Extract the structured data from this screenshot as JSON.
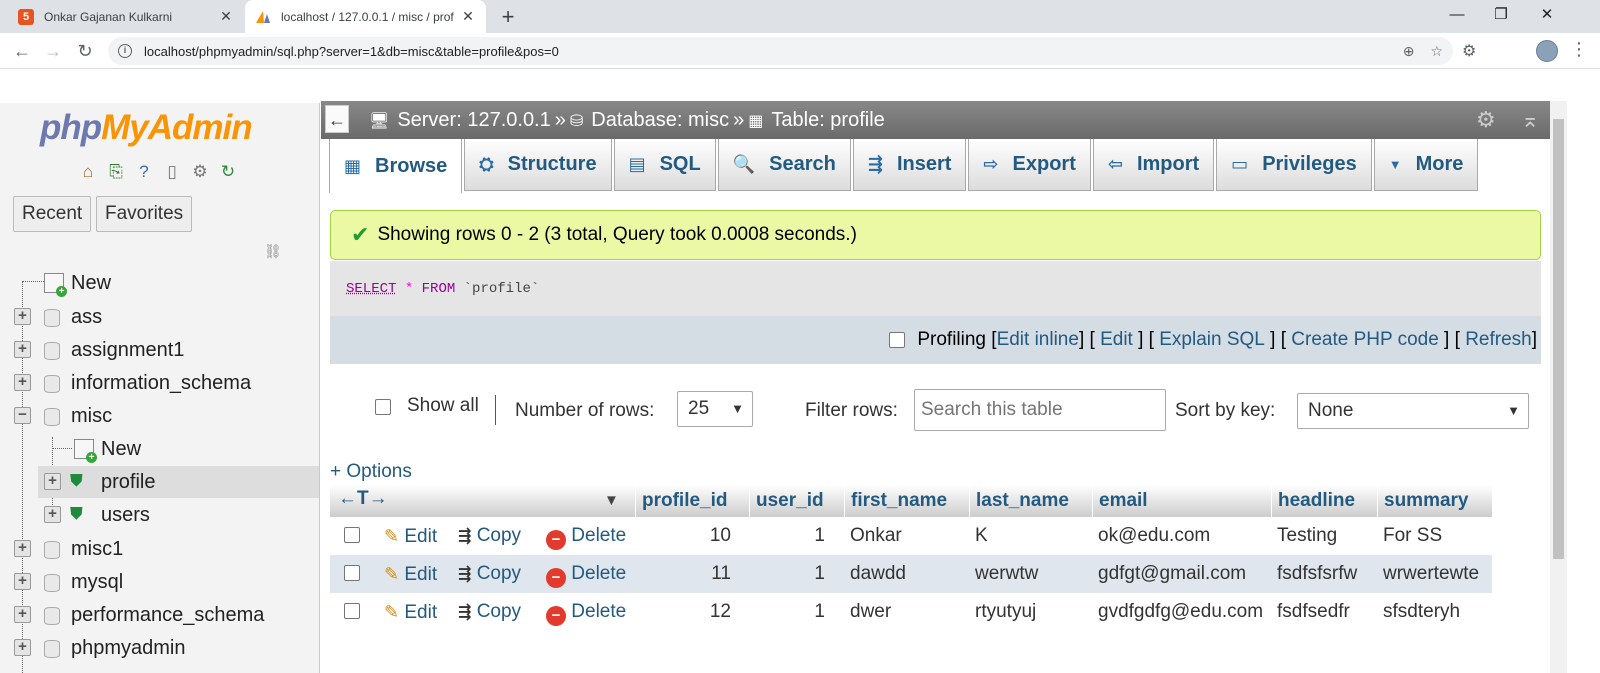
{
  "browser": {
    "tabs": [
      {
        "title": "Onkar Gajanan Kulkarni",
        "active": false
      },
      {
        "title": "localhost / 127.0.0.1 / misc / prof",
        "active": true
      }
    ],
    "url": "localhost/phpmyadmin/sql.php?server=1&db=misc&table=profile&pos=0",
    "new_tab": "+",
    "controls": {
      "minimize": "—",
      "maximize": "❐",
      "close": "✕"
    }
  },
  "nav": {
    "logo_php": "php",
    "logo_myadmin": "MyAdmin",
    "recent": "Recent",
    "favorites": "Favorites",
    "tree": [
      {
        "label": "New"
      },
      {
        "label": "ass"
      },
      {
        "label": "assignment1"
      },
      {
        "label": "information_schema"
      },
      {
        "label": "misc"
      },
      {
        "label": "New"
      },
      {
        "label": "profile"
      },
      {
        "label": "users"
      },
      {
        "label": "misc1"
      },
      {
        "label": "mysql"
      },
      {
        "label": "performance_schema"
      },
      {
        "label": "phpmyadmin"
      }
    ]
  },
  "breadcrumb": {
    "server": "Server: 127.0.0.1",
    "sep": "»",
    "database": "Database: misc",
    "table": "Table: profile"
  },
  "tabs": [
    {
      "label": "Browse",
      "icon": "▦"
    },
    {
      "label": "Structure",
      "icon": "⛭"
    },
    {
      "label": "SQL",
      "icon": "▤"
    },
    {
      "label": "Search",
      "icon": "🔍"
    },
    {
      "label": "Insert",
      "icon": "⇶"
    },
    {
      "label": "Export",
      "icon": "⇨"
    },
    {
      "label": "Import",
      "icon": "⇦"
    },
    {
      "label": "Privileges",
      "icon": "▭"
    },
    {
      "label": "More",
      "icon": "▼"
    }
  ],
  "message": "Showing rows 0 - 2 (3 total, Query took 0.0008 seconds.)",
  "sql": {
    "select": "SELECT",
    "star": "*",
    "from": "FROM",
    "table": "`profile`"
  },
  "tools": {
    "profiling": "Profiling",
    "edit_inline": "Edit inline",
    "edit": "Edit",
    "explain": "Explain SQL",
    "create_php": "Create PHP code",
    "refresh": "Refresh"
  },
  "filter": {
    "show_all": "Show all",
    "num_rows_label": "Number of rows:",
    "num_rows_value": "25",
    "filter_label": "Filter rows:",
    "filter_placeholder": "Search this table",
    "sort_label": "Sort by key:",
    "sort_value": "None"
  },
  "options_link": "+ Options",
  "grid": {
    "headers": [
      "profile_id",
      "user_id",
      "first_name",
      "last_name",
      "email",
      "headline",
      "summary"
    ],
    "actions": {
      "edit": "Edit",
      "copy": "Copy",
      "delete": "Delete"
    },
    "rows": [
      [
        "10",
        "1",
        "Onkar",
        "K",
        "ok@edu.com",
        "Testing",
        "For SS"
      ],
      [
        "11",
        "1",
        "dawdd",
        "werwtw",
        "gdfgt@gmail.com",
        "fsdfsfsrfw",
        "wrwertewte"
      ],
      [
        "12",
        "1",
        "dwer",
        "rtyutyuj",
        "gvdfgdfg@edu.com",
        "fsdfsedfr",
        "sfsdteryh"
      ]
    ]
  }
}
